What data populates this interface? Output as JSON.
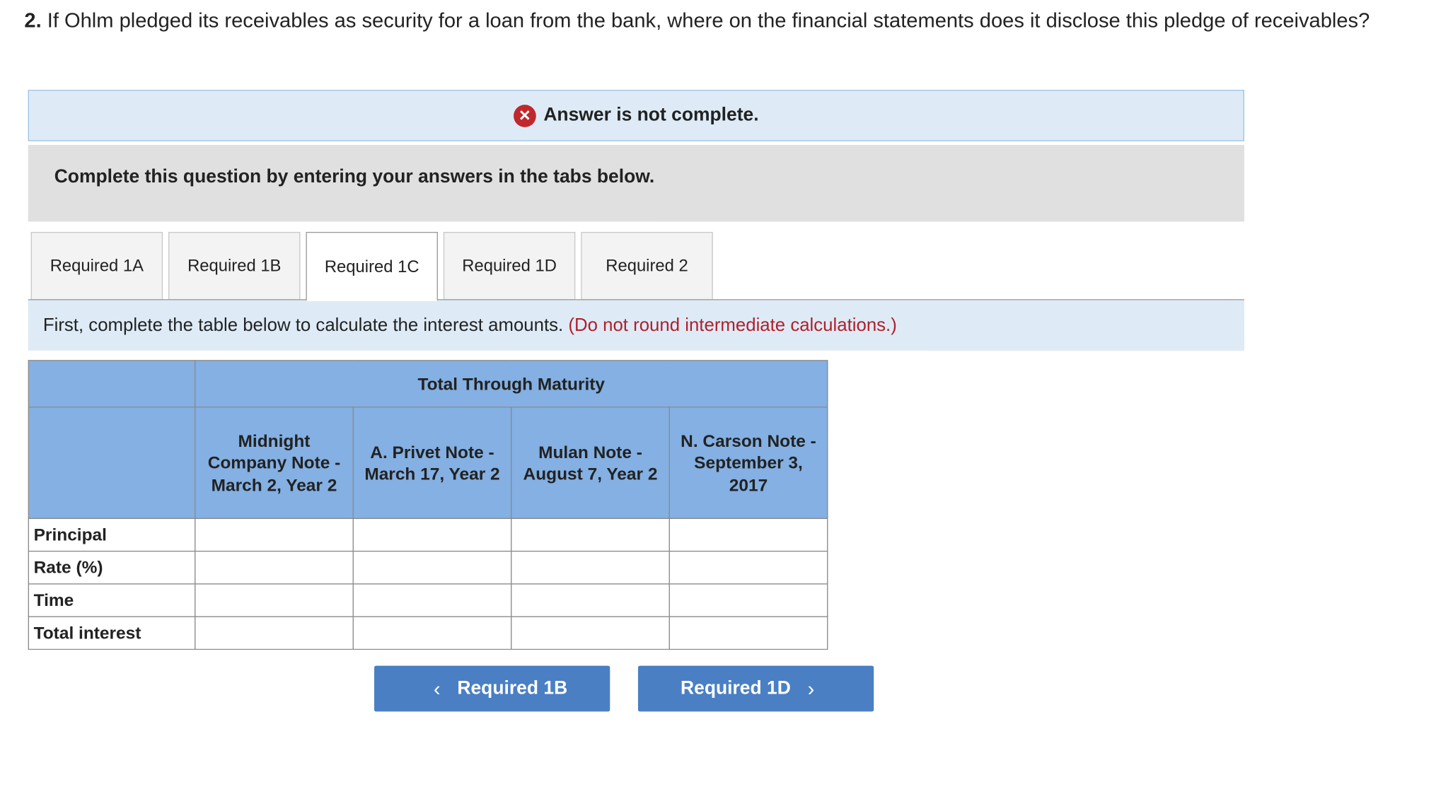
{
  "question": {
    "number": "2.",
    "text": " If Ohlm pledged its receivables as security for a loan from the bank, where on the financial statements does it disclose this pledge of receivables?"
  },
  "status": {
    "icon": "x-circle-icon",
    "text": "Answer is not complete."
  },
  "instruction": "Complete this question by entering your answers in the tabs below.",
  "tabs": [
    {
      "label": "Required 1A"
    },
    {
      "label": "Required 1B"
    },
    {
      "label": "Required 1C"
    },
    {
      "label": "Required 1D"
    },
    {
      "label": "Required 2"
    }
  ],
  "active_tab": "Required 1C",
  "note": {
    "text": "First, complete the table below to calculate the interest amounts.",
    "hint": "(Do not round intermediate calculations.)"
  },
  "table": {
    "group_header": "Total Through Maturity",
    "columns": [
      {
        "label": "Midnight Company Note - March 2, Year 2"
      },
      {
        "label": "A. Privet Note - March 17, Year 2"
      },
      {
        "label": "Mulan Note - August 7, Year 2"
      },
      {
        "label": "N. Carson Note - September 3, 2017"
      }
    ],
    "rows": [
      {
        "label": "Principal"
      },
      {
        "label": "Rate (%)"
      },
      {
        "label": "Time"
      },
      {
        "label": "Total interest"
      }
    ]
  },
  "nav": {
    "prev_label": "Required 1B",
    "next_label": "Required 1D"
  },
  "colors": {
    "header_blue": "#84b0e3",
    "button_blue": "#4a7fc4",
    "hint_red": "#b0202a",
    "status_bg": "#deebf7"
  }
}
